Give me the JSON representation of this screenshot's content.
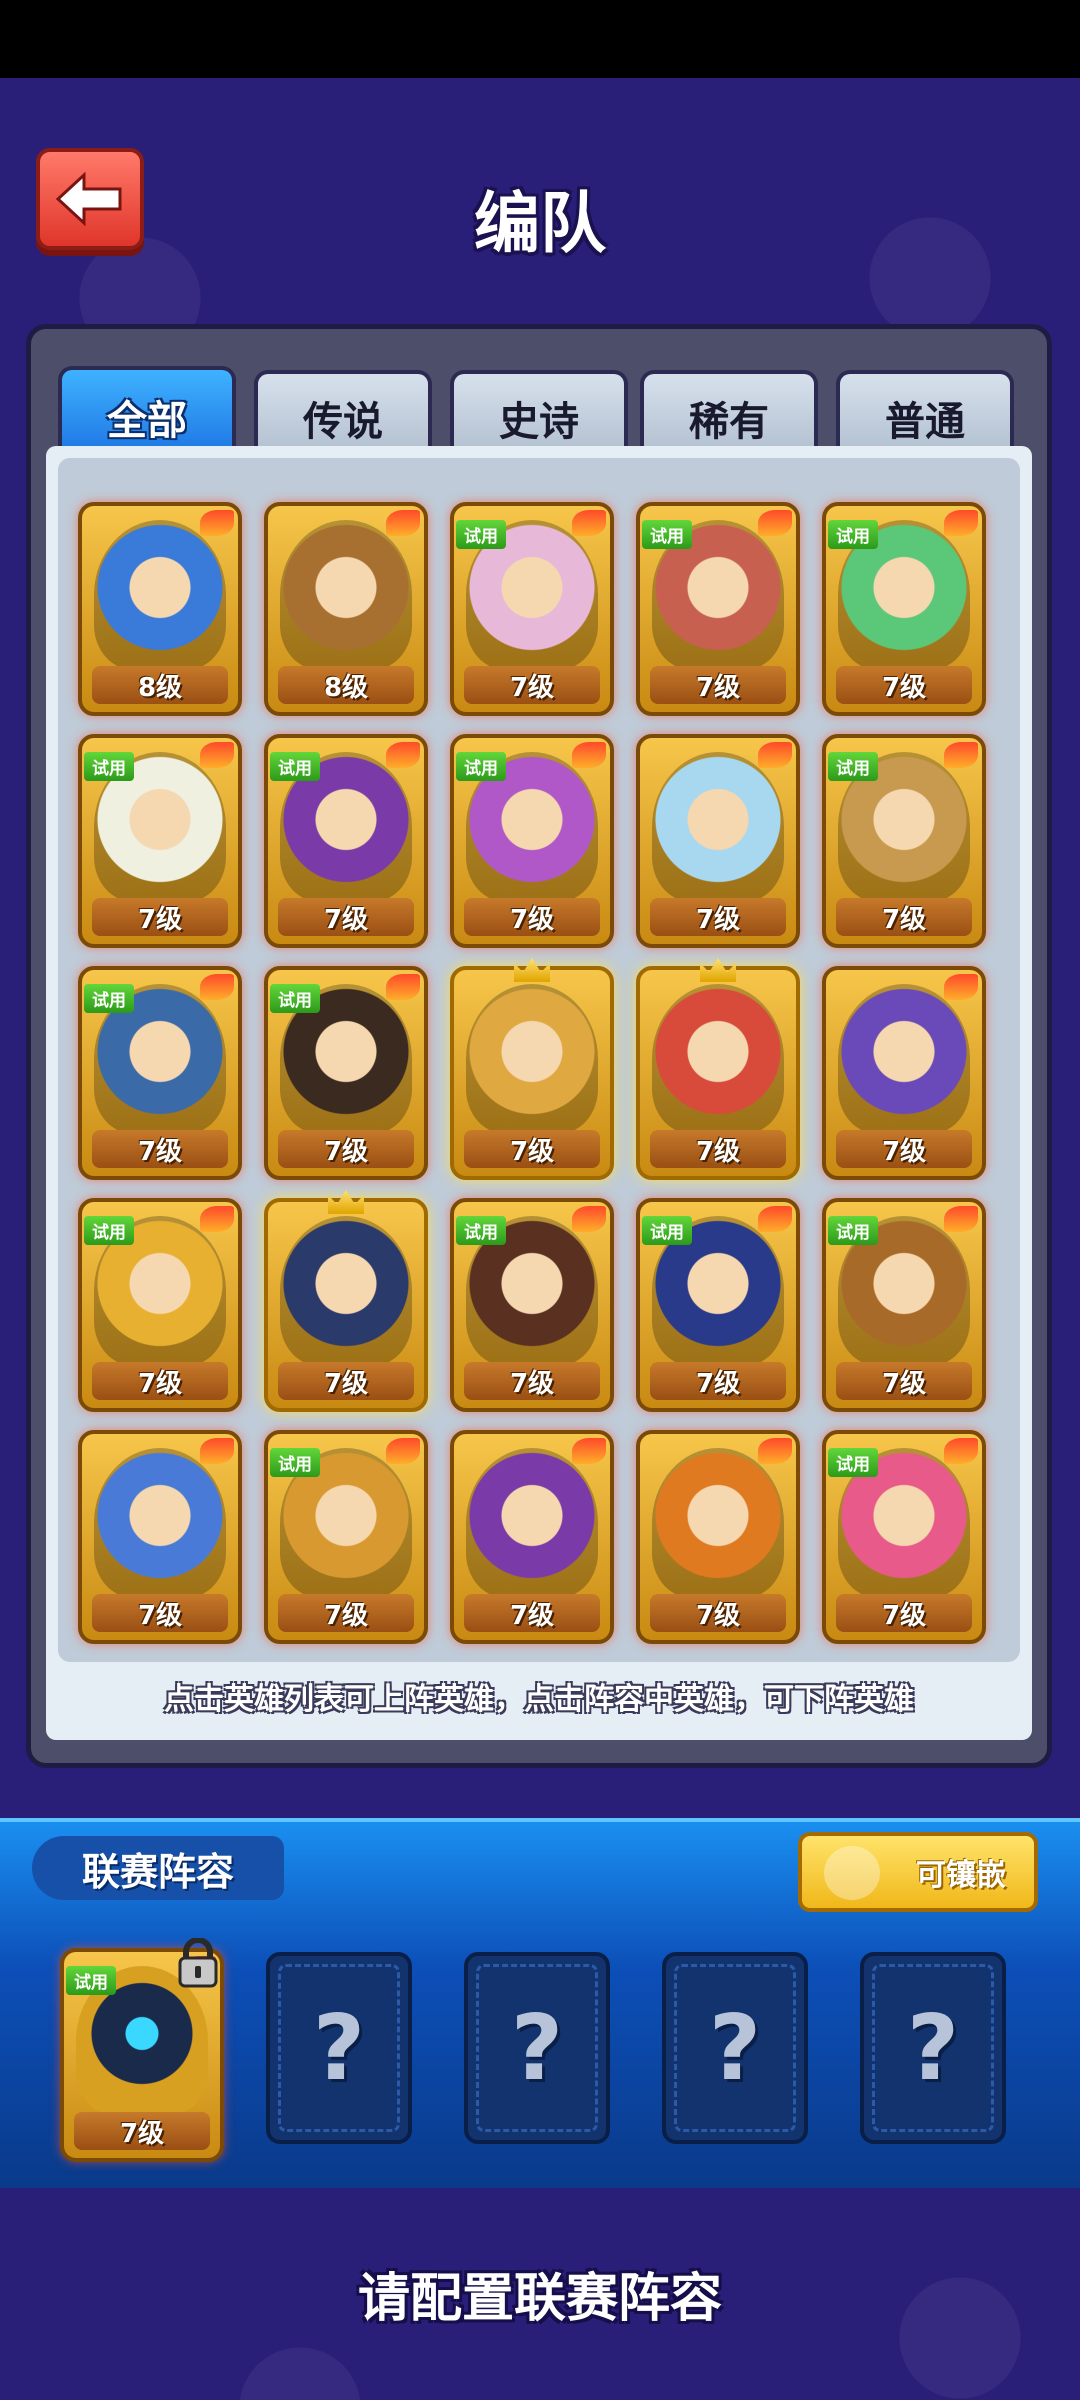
{
  "header": {
    "title": "编队"
  },
  "tabs": [
    {
      "label": "全部",
      "active": true
    },
    {
      "label": "传说",
      "active": false
    },
    {
      "label": "史诗",
      "active": false
    },
    {
      "label": "稀有",
      "active": false
    },
    {
      "label": "普通",
      "active": false
    }
  ],
  "heroes": [
    {
      "level": "8级",
      "trial": "",
      "color": "#3a7ad8"
    },
    {
      "level": "8级",
      "trial": "",
      "color": "#a87030"
    },
    {
      "level": "7级",
      "trial": "试用",
      "color": "#e8b8d8"
    },
    {
      "level": "7级",
      "trial": "试用",
      "color": "#c86050"
    },
    {
      "level": "7级",
      "trial": "试用",
      "color": "#5ac878"
    },
    {
      "level": "7级",
      "trial": "试用",
      "color": "#f0f0e0"
    },
    {
      "level": "7级",
      "trial": "试用",
      "color": "#7a3aa8"
    },
    {
      "level": "7级",
      "trial": "试用",
      "color": "#b058c8"
    },
    {
      "level": "7级",
      "trial": "",
      "color": "#a8d8f0"
    },
    {
      "level": "7级",
      "trial": "试用",
      "color": "#c89a50"
    },
    {
      "level": "7级",
      "trial": "试用",
      "color": "#3a6aa8"
    },
    {
      "level": "7级",
      "trial": "试用",
      "color": "#3a2a20"
    },
    {
      "level": "7级",
      "trial": "",
      "color": "#e0a840"
    },
    {
      "level": "7级",
      "trial": "",
      "color": "#d84a3a"
    },
    {
      "level": "7级",
      "trial": "",
      "color": "#6a4ab8"
    },
    {
      "level": "7级",
      "trial": "试用",
      "color": "#e8b030"
    },
    {
      "level": "7级",
      "trial": "",
      "color": "#2a3a6a"
    },
    {
      "level": "7级",
      "trial": "试用",
      "color": "#5a3020"
    },
    {
      "level": "7级",
      "trial": "试用",
      "color": "#2a3a8a"
    },
    {
      "level": "7级",
      "trial": "试用",
      "color": "#a86a28"
    },
    {
      "level": "7级",
      "trial": "",
      "color": "#4a7ad8"
    },
    {
      "level": "7级",
      "trial": "试用",
      "color": "#d89a30"
    },
    {
      "level": "7级",
      "trial": "",
      "color": "#7a3aa8"
    },
    {
      "level": "7级",
      "trial": "",
      "color": "#e07a20"
    },
    {
      "level": "7级",
      "trial": "试用",
      "color": "#e85a8a"
    }
  ],
  "hint": "点击英雄列表可上阵英雄，点击阵容中英雄，可下阵英雄",
  "league": {
    "title": "联赛阵容",
    "embed_button": "可镶嵌",
    "slot_hero": {
      "level": "7级",
      "trial": "试用",
      "color": "#1a2a4a"
    },
    "empty_slots": [
      "?",
      "?",
      "?",
      "?"
    ]
  },
  "bottom_prompt": "请配置联赛阵容"
}
